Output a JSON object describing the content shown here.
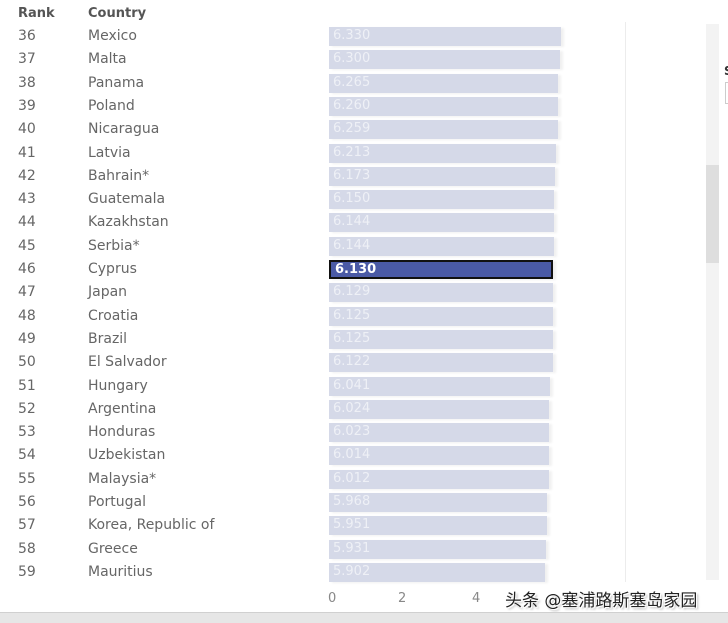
{
  "header": {
    "rank": "Rank",
    "country": "Country"
  },
  "selected_country": "Cyprus",
  "colors": {
    "bar": "#d5d9e8",
    "bar_selected": "#4a5aa6",
    "selected_border": "#111111"
  },
  "right_panel": {
    "label": "S"
  },
  "watermark": "头条 @塞浦路斯塞岛家园",
  "chart_data": {
    "type": "bar",
    "orientation": "horizontal",
    "title": "",
    "xlabel": "",
    "ylabel": "",
    "xlim": [
      0,
      4
    ],
    "x_ticks": [
      "0",
      "2",
      "4"
    ],
    "columns": [
      "Rank",
      "Country"
    ],
    "categories": [
      "Mexico",
      "Malta",
      "Panama",
      "Poland",
      "Nicaragua",
      "Latvia",
      "Bahrain*",
      "Guatemala",
      "Kazakhstan",
      "Serbia*",
      "Cyprus",
      "Japan",
      "Croatia",
      "Brazil",
      "El Salvador",
      "Hungary",
      "Argentina",
      "Honduras",
      "Uzbekistan",
      "Malaysia*",
      "Portugal",
      "Korea, Republic of",
      "Greece",
      "Mauritius"
    ],
    "ranks": [
      "36",
      "37",
      "38",
      "39",
      "40",
      "41",
      "42",
      "43",
      "44",
      "45",
      "46",
      "47",
      "48",
      "49",
      "50",
      "51",
      "52",
      "53",
      "54",
      "55",
      "56",
      "57",
      "58",
      "59"
    ],
    "values": [
      6.33,
      6.3,
      6.265,
      6.26,
      6.259,
      6.213,
      6.173,
      6.15,
      6.144,
      6.144,
      6.13,
      6.129,
      6.125,
      6.125,
      6.122,
      6.041,
      6.024,
      6.023,
      6.014,
      6.012,
      5.968,
      5.951,
      5.931,
      5.902
    ],
    "labels": [
      "6.330",
      "6.300",
      "6.265",
      "6.260",
      "6.259",
      "6.213",
      "6.173",
      "6.150",
      "6.144",
      "6.144",
      "6.130",
      "6.129",
      "6.125",
      "6.125",
      "6.122",
      "6.041",
      "6.024",
      "6.023",
      "6.014",
      "6.012",
      "5.968",
      "5.951",
      "5.931",
      "5.902"
    ],
    "highlighted": "Cyprus",
    "grid": false
  }
}
